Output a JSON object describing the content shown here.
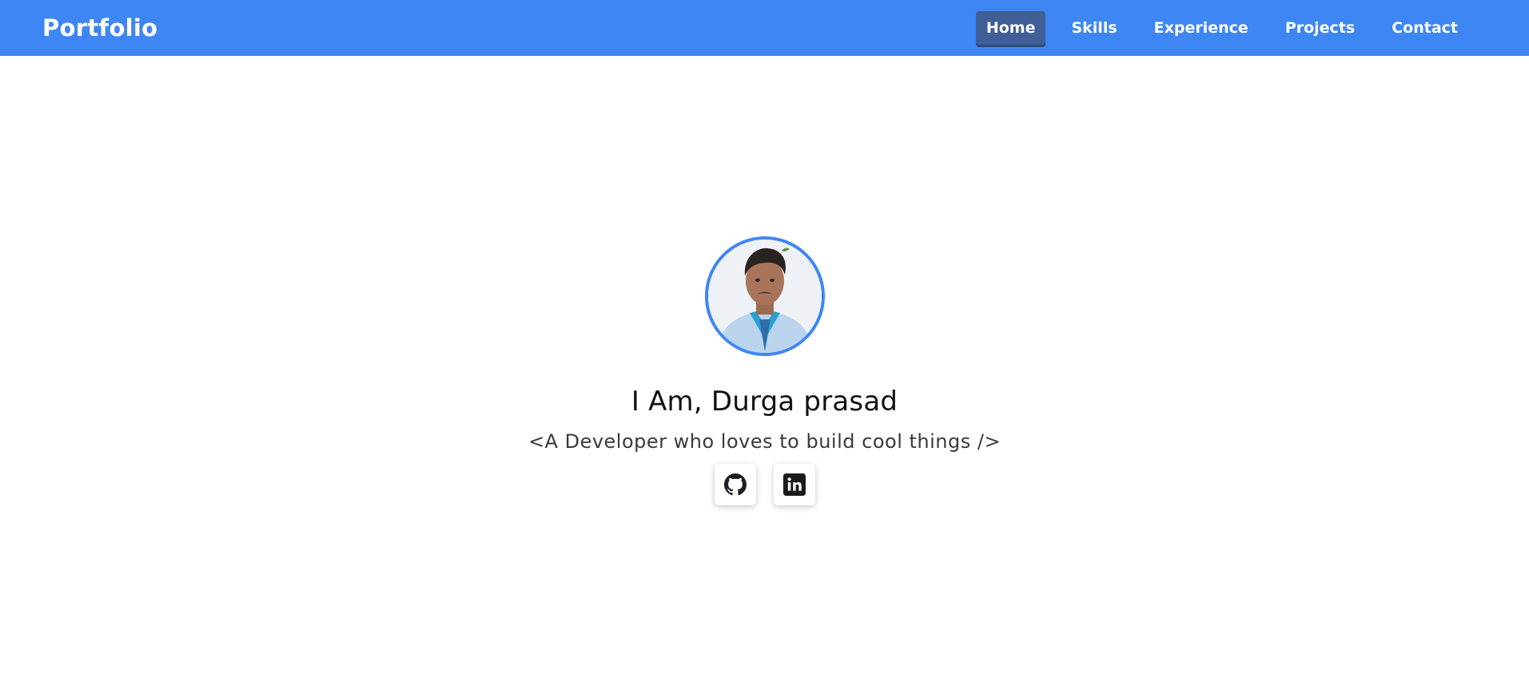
{
  "navbar": {
    "brand": "Portfolio",
    "links": [
      {
        "label": "Home",
        "active": true
      },
      {
        "label": "Skills",
        "active": false
      },
      {
        "label": "Experience",
        "active": false
      },
      {
        "label": "Projects",
        "active": false
      },
      {
        "label": "Contact",
        "active": false
      }
    ]
  },
  "hero": {
    "title": "I Am, Durga prasad",
    "tagline": "<A Developer who loves to build cool things />",
    "socials": [
      {
        "icon": "github-icon"
      },
      {
        "icon": "linkedin-icon"
      }
    ]
  },
  "colors": {
    "primary": "#3e86f3",
    "active_nav": "#3f5f96"
  }
}
